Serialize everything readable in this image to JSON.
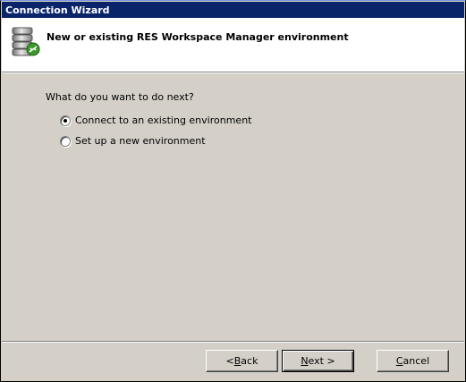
{
  "window": {
    "title": "Connection Wizard"
  },
  "header": {
    "icon": "database-connection-icon",
    "title": "New or existing RES Workspace Manager environment"
  },
  "main": {
    "question": "What do you want to do next?",
    "options": [
      {
        "label": "Connect to an existing environment",
        "selected": true
      },
      {
        "label": "Set up a new environment",
        "selected": false
      }
    ]
  },
  "footer": {
    "back": {
      "prefix": "< ",
      "mnemonic": "B",
      "rest": "ack"
    },
    "next": {
      "mnemonic": "N",
      "rest": "ext >"
    },
    "cancel": {
      "mnemonic": "C",
      "rest": "ancel"
    }
  },
  "colors": {
    "titlebar": "#0a246a",
    "face": "#d4d0c8",
    "header_bg": "#ffffff"
  }
}
